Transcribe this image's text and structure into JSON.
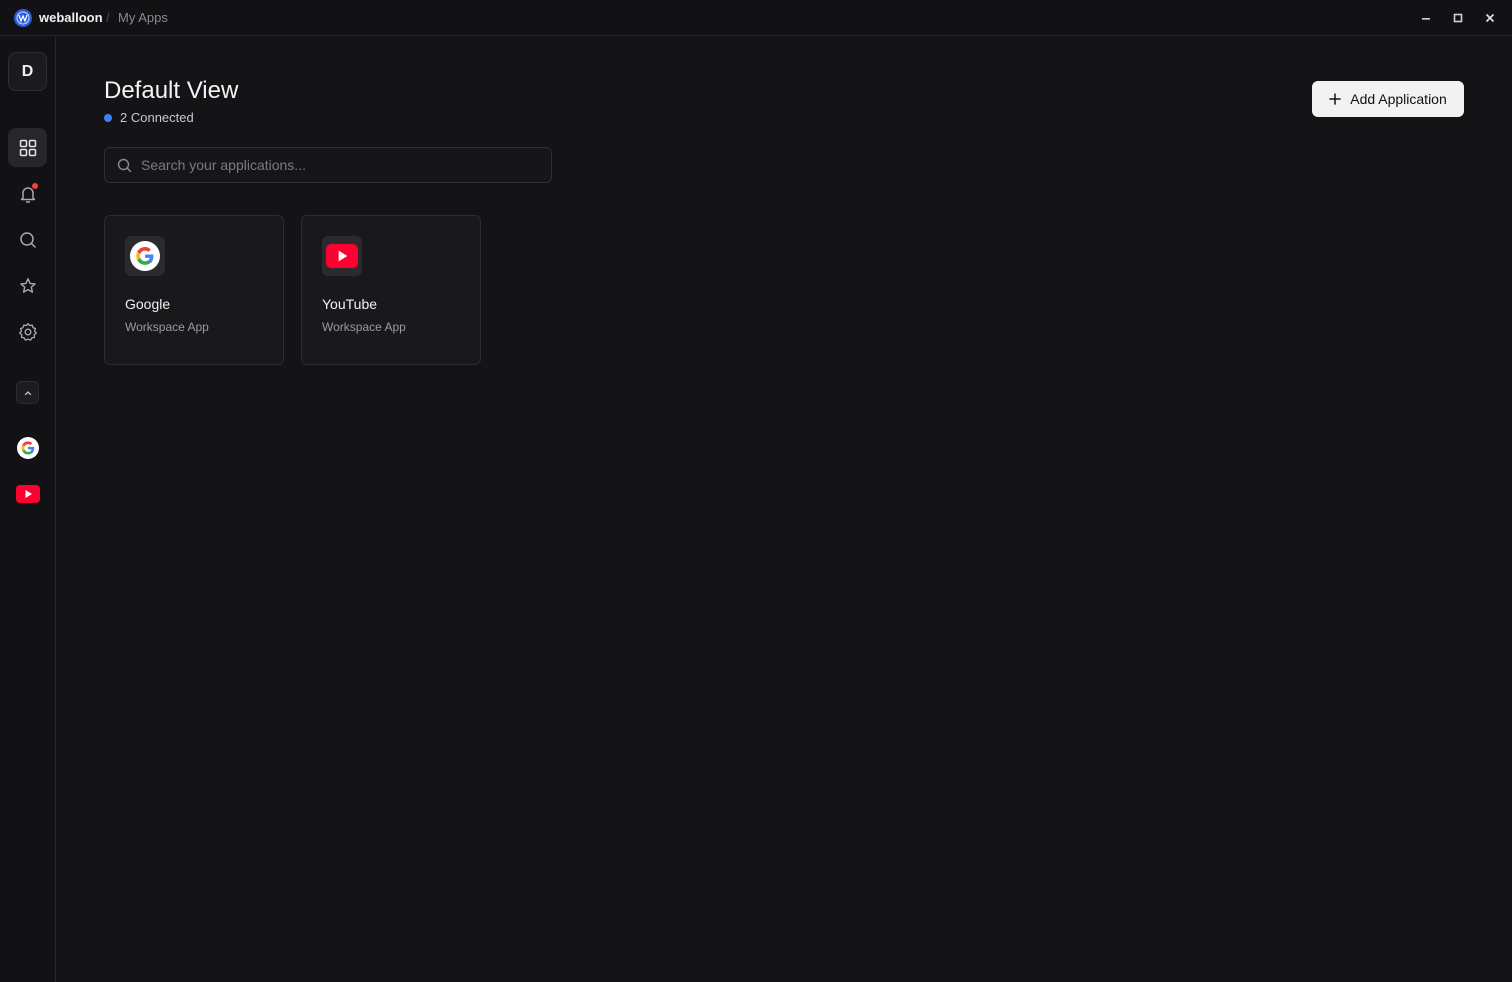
{
  "titlebar": {
    "brand": "weballoon",
    "separator": "/",
    "breadcrumb": "My Apps"
  },
  "sidebar": {
    "avatar_letter": "D",
    "nav": [
      {
        "icon": "grid-icon",
        "active": true
      },
      {
        "icon": "bell-icon",
        "notification": true
      },
      {
        "icon": "search-icon"
      },
      {
        "icon": "star-icon"
      },
      {
        "icon": "gear-icon"
      }
    ],
    "apps": [
      "google-icon",
      "youtube-icon"
    ]
  },
  "main": {
    "title": "Default View",
    "status": "2 Connected",
    "add_button": "Add Application",
    "search_placeholder": "Search your applications..."
  },
  "apps": [
    {
      "name": "Google",
      "subtitle": "Workspace App"
    },
    {
      "name": "YouTube",
      "subtitle": "Workspace App"
    }
  ],
  "colors": {
    "background": "#141416",
    "status_dot": "#3b82f6",
    "notification": "#ef4444",
    "youtube_red": "#ff0033"
  }
}
